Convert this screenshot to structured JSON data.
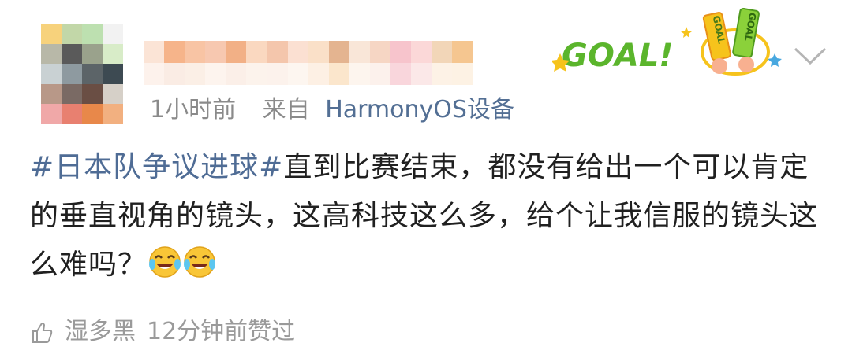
{
  "post": {
    "time": "1小时前",
    "from_label": "来自",
    "device": "HarmonyOS设备",
    "hashtag": "#日本队争议进球#",
    "text": "直到比赛结束，都没有给出一个可以肯定的垂直视角的镜头，这高科技这么多，给个让我信服的镜头这么难吗？",
    "emojis": [
      "laugh-cry-emoji",
      "laugh-cry-emoji"
    ]
  },
  "badge": {
    "text": "GOAL!",
    "icon": "goal-badge-icon"
  },
  "menu": {
    "icon": "chevron-down-icon"
  },
  "footer": {
    "icon": "like-icon",
    "user": "湿多黑",
    "action": "12分钟前赞过"
  },
  "colors": {
    "tag": "#4f6c95",
    "device": "#536f94",
    "meta": "#8a8a8a",
    "text": "#202020",
    "badge_green": "#5bb52c"
  },
  "avatar_pixels": [
    "#f7d27c",
    "#c2d7a8",
    "#bde0b0",
    "#f2f2f2",
    "#b8b8a8",
    "#5a5a5a",
    "#9aa28c",
    "#d8ecc8",
    "#c9d1d3",
    "#8e9aa0",
    "#5c6468",
    "#3d4a52",
    "#b89888",
    "#7a6a64",
    "#6a4e44",
    "#d6d0c8",
    "#f0a8a8",
    "#e88070",
    "#e8884a",
    "#f2b080"
  ],
  "username_pixels": [
    "#fbe4d6",
    "#f6b48a",
    "#f8c4a4",
    "#f7c8b0",
    "#f2b086",
    "#fad8c0",
    "#f4c6ac",
    "#fbe0d2",
    "#fae0c8",
    "#e4b490",
    "#f9e6d8",
    "#f6d6c4",
    "#f7c4cc",
    "#fbd8d8",
    "#f2d6b8",
    "#f5c690",
    "#fdf2ec",
    "#faece4",
    "#fbefe6",
    "#fdf4ee",
    "#fbefe8",
    "#fcf3ec",
    "#fcf2ec",
    "#fdf6f0",
    "#fdf0e4",
    "#fbe6cc",
    "#fdf5ee",
    "#fcf1ec",
    "#f9d6dc",
    "#fbe8e8",
    "#fdf2e6",
    "#fdf2e4"
  ]
}
